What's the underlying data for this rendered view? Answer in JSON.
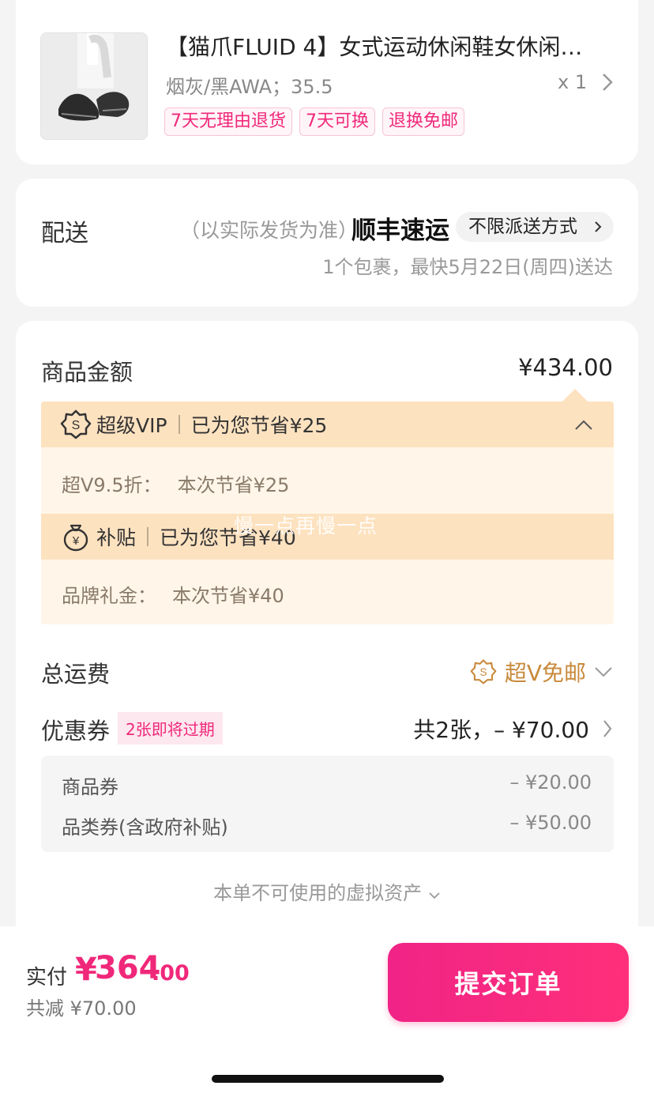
{
  "product": {
    "title": "【猫爪FLUID 4】女式运动休闲鞋女休闲…",
    "sku": "烟灰/黑AWA；35.5",
    "qty": "x 1",
    "tags": [
      "7天无理由退货",
      "7天可换",
      "退换免邮"
    ]
  },
  "delivery": {
    "label": "配送",
    "note": "（以实际发货为准）",
    "carrier": "顺丰速运",
    "method": "不限派送方式",
    "eta": "1个包裹，最快5月22日(周四)送达"
  },
  "price": {
    "goods_label": "商品金额",
    "goods_amount": "¥434.00",
    "vip": {
      "name": "超级VIP",
      "saved": "已为您节省¥25",
      "detail_label": "超V9.5折：",
      "detail_value": "本次节省¥25"
    },
    "subsidy": {
      "name": "补贴",
      "saved": "已为您节省¥40",
      "detail_label": "品牌礼金：",
      "detail_value": "本次节省¥40"
    },
    "watermark": "慢一点再慢一点",
    "shipping_label": "总运费",
    "shipping_value": "超V免邮",
    "coupon_label": "优惠券",
    "coupon_badge": "2张即将过期",
    "coupon_value": "共2张，– ¥70.00",
    "coupons": [
      {
        "name": "商品券",
        "amount": "– ¥20.00"
      },
      {
        "name": "品类券(含政府补贴)",
        "amount": "– ¥50.00"
      }
    ],
    "virtual_assets": "本单不可使用的虚拟资产"
  },
  "footer": {
    "pay_label": "实付",
    "currency": "¥",
    "pay_int": "364",
    "pay_dec": ".00",
    "saved_total": "共减 ¥70.00",
    "submit": "提交订单"
  },
  "colors": {
    "accent": "#f0287a",
    "vip_gold": "#c98a3c"
  }
}
